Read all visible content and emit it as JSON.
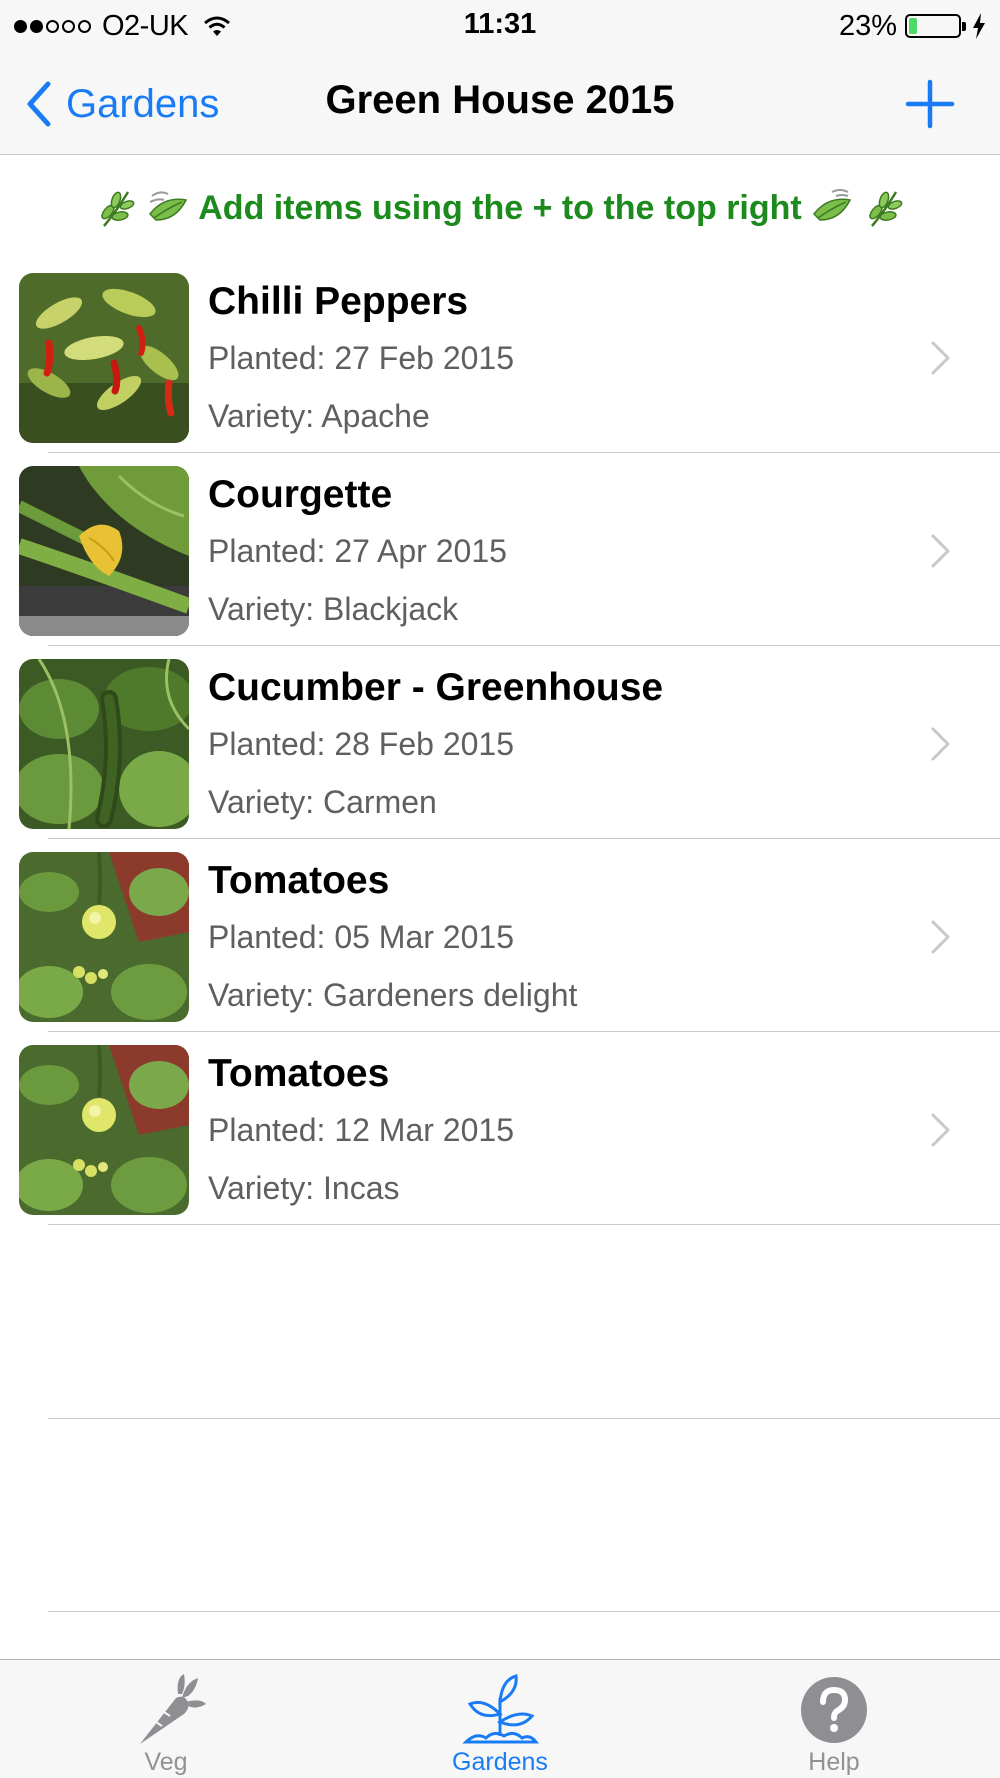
{
  "status": {
    "carrier": "O2-UK",
    "time": "11:31",
    "battery_text": "23%",
    "battery_level": 0.23,
    "signal_bars_filled": 2,
    "signal_bars_total": 5
  },
  "nav": {
    "back_label": "Gardens",
    "title": "Green House 2015",
    "add_icon": "plus-icon"
  },
  "hint": {
    "text": "Add items using the + to the top right"
  },
  "items": [
    {
      "title": "Chilli Peppers",
      "planted": "Planted: 27 Feb 2015",
      "variety": "Variety: Apache",
      "photo": "chilli-photo"
    },
    {
      "title": "Courgette",
      "planted": "Planted: 27 Apr 2015",
      "variety": "Variety: Blackjack",
      "photo": "courgette-photo"
    },
    {
      "title": "Cucumber - Greenhouse",
      "planted": "Planted: 28 Feb 2015",
      "variety": "Variety: Carmen",
      "photo": "cucumber-photo"
    },
    {
      "title": "Tomatoes",
      "planted": "Planted: 05 Mar 2015",
      "variety": "Variety: Gardeners delight",
      "photo": "tomato-photo"
    },
    {
      "title": "Tomatoes",
      "planted": "Planted: 12 Mar 2015",
      "variety": "Variety: Incas",
      "photo": "tomato-photo"
    }
  ],
  "tabs": [
    {
      "label": "Veg",
      "icon": "carrot-icon",
      "active": false
    },
    {
      "label": "Gardens",
      "icon": "seedling-icon",
      "active": true
    },
    {
      "label": "Help",
      "icon": "help-icon",
      "active": false
    }
  ],
  "colors": {
    "accent": "#1a7cf5",
    "hint_green": "#1d8a1d",
    "secondary_text": "#5f5f5f",
    "battery_green": "#4cd964"
  }
}
